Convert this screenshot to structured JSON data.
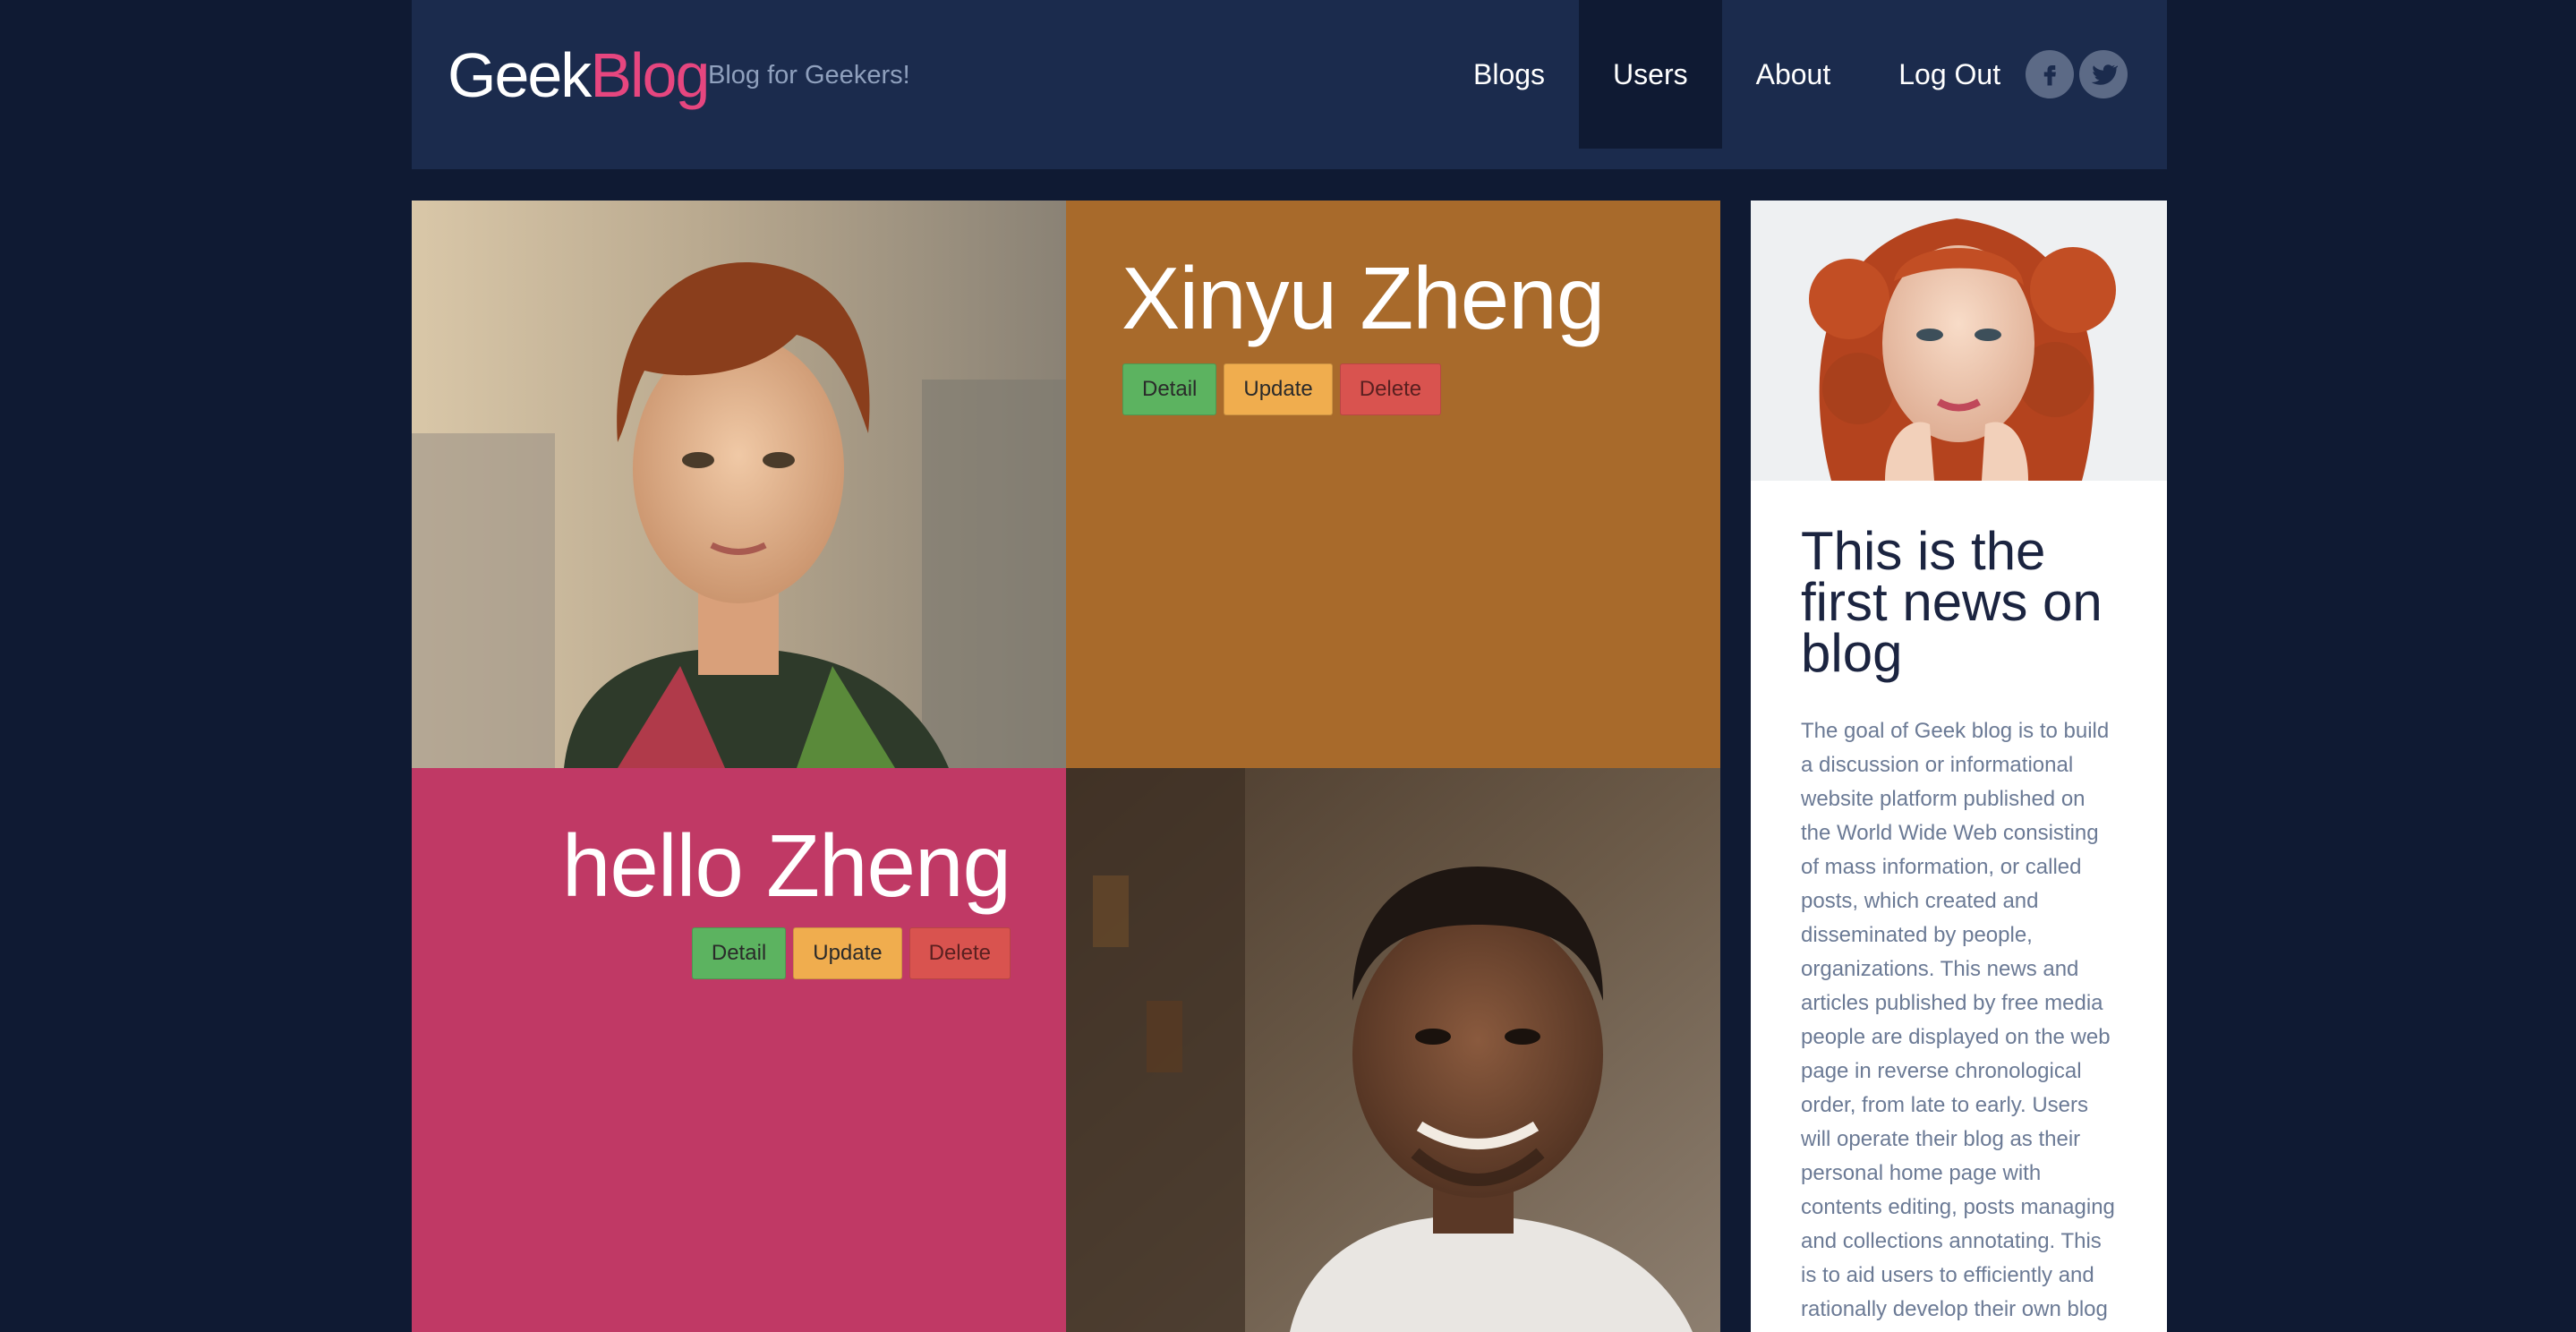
{
  "header": {
    "logo_part1": "Geek",
    "logo_part2": "Blog",
    "tagline": "Blog for Geekers!",
    "nav": [
      {
        "label": "Blogs",
        "active": false
      },
      {
        "label": "Users",
        "active": true
      },
      {
        "label": "About",
        "active": false
      },
      {
        "label": "Log Out",
        "active": false
      }
    ],
    "social": [
      "facebook-icon",
      "twitter-icon"
    ]
  },
  "users": [
    {
      "name": "Xinyu Zheng",
      "card_color": "#a86a2b",
      "buttons": {
        "detail": "Detail",
        "update": "Update",
        "delete": "Delete"
      }
    },
    {
      "name": "hello Zheng",
      "card_color": "#c03965",
      "buttons": {
        "detail": "Detail",
        "update": "Update",
        "delete": "Delete"
      }
    }
  ],
  "sidebar": {
    "news_title": "This is the first news on blog",
    "news_body": "The goal of Geek blog is to build a discussion or informational website platform published on the World Wide Web consisting of mass information, or called posts, which created and disseminated by people, organizations. This news and articles published by free media people are displayed on the web page in reverse chronological order, from late to early. Users will operate their blog as their personal home page with contents editing, posts managing and collections annotating. This is to aid users to efficiently and rationally develop their own blog"
  },
  "colors": {
    "background": "#0f1a33",
    "header": "#1b2b4d",
    "brand_pink": "#e6467f",
    "detail": "#5cb360",
    "update": "#f0ad4e",
    "delete": "#d9534f"
  }
}
